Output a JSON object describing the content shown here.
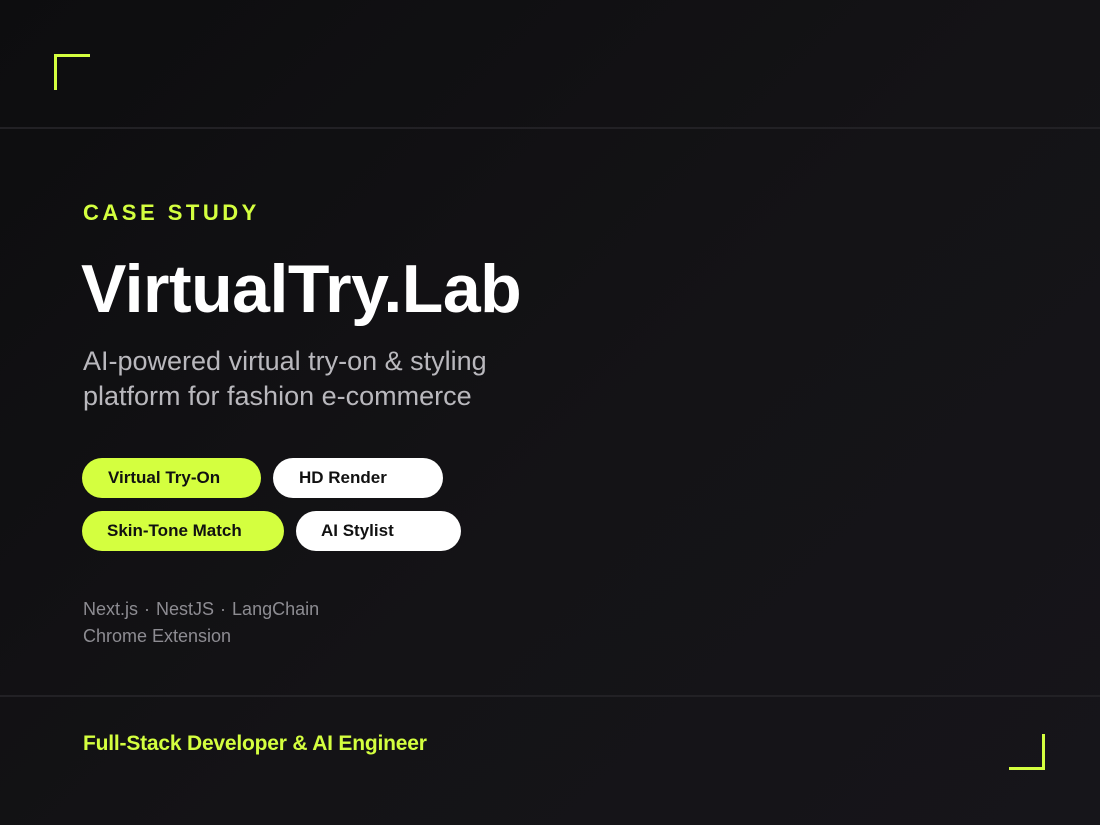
{
  "header": {
    "eyebrow": "CASE STUDY",
    "title": "VirtualTry.Lab",
    "subtitle_line1": "AI-powered virtual try-on & styling",
    "subtitle_line2": "platform for fashion e-commerce"
  },
  "tags": [
    {
      "label": "Virtual Try-On",
      "style": "lime"
    },
    {
      "label": "HD Render",
      "style": "white"
    },
    {
      "label": "Skin-Tone Match",
      "style": "lime"
    },
    {
      "label": "AI Stylist",
      "style": "white"
    }
  ],
  "tech_stack": {
    "items": [
      "Next.js",
      "NestJS",
      "LangChain"
    ],
    "separator": "·",
    "second_line": "Chrome Extension"
  },
  "footer": {
    "role": "Full-Stack Developer & AI Engineer"
  },
  "colors": {
    "accent": "#d4ff3f",
    "background": "#111013",
    "title": "#ffffff",
    "muted": "#8d8c92"
  },
  "icons": {
    "top_left": "corner-bracket-icon",
    "bottom_right": "corner-bracket-icon"
  }
}
